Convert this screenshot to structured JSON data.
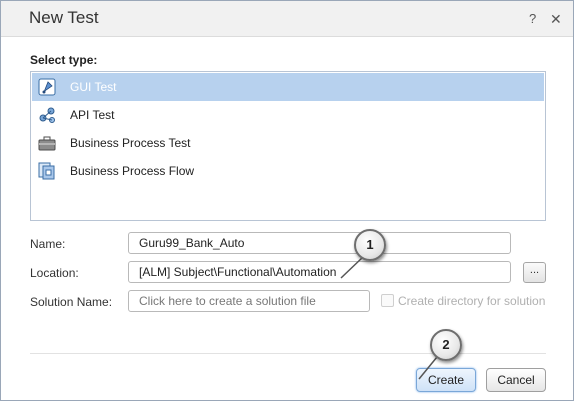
{
  "dialog": {
    "title": "New Test",
    "help_glyph": "?",
    "close_glyph": "✕"
  },
  "select_type": {
    "label": "Select type:",
    "items": [
      {
        "label": "GUI Test",
        "icon": "gui-test-icon",
        "selected": true
      },
      {
        "label": "API Test",
        "icon": "api-test-icon",
        "selected": false
      },
      {
        "label": "Business Process Test",
        "icon": "business-process-test-icon",
        "selected": false
      },
      {
        "label": "Business Process Flow",
        "icon": "business-process-flow-icon",
        "selected": false
      }
    ]
  },
  "form": {
    "name_label": "Name:",
    "name_value": "Guru99_Bank_Auto",
    "location_label": "Location:",
    "location_value": "[ALM] Subject\\Functional\\Automation",
    "browse_label": "...",
    "solution_label": "Solution Name:",
    "solution_placeholder": "Click here to create a solution file",
    "create_dir_label": "Create directory for solution",
    "create_dir_checked": false
  },
  "buttons": {
    "create": "Create",
    "cancel": "Cancel"
  },
  "callouts": {
    "one": "1",
    "two": "2"
  },
  "colors": {
    "selected_row": "#b7d1ee",
    "accent": "#7aa7d8"
  }
}
